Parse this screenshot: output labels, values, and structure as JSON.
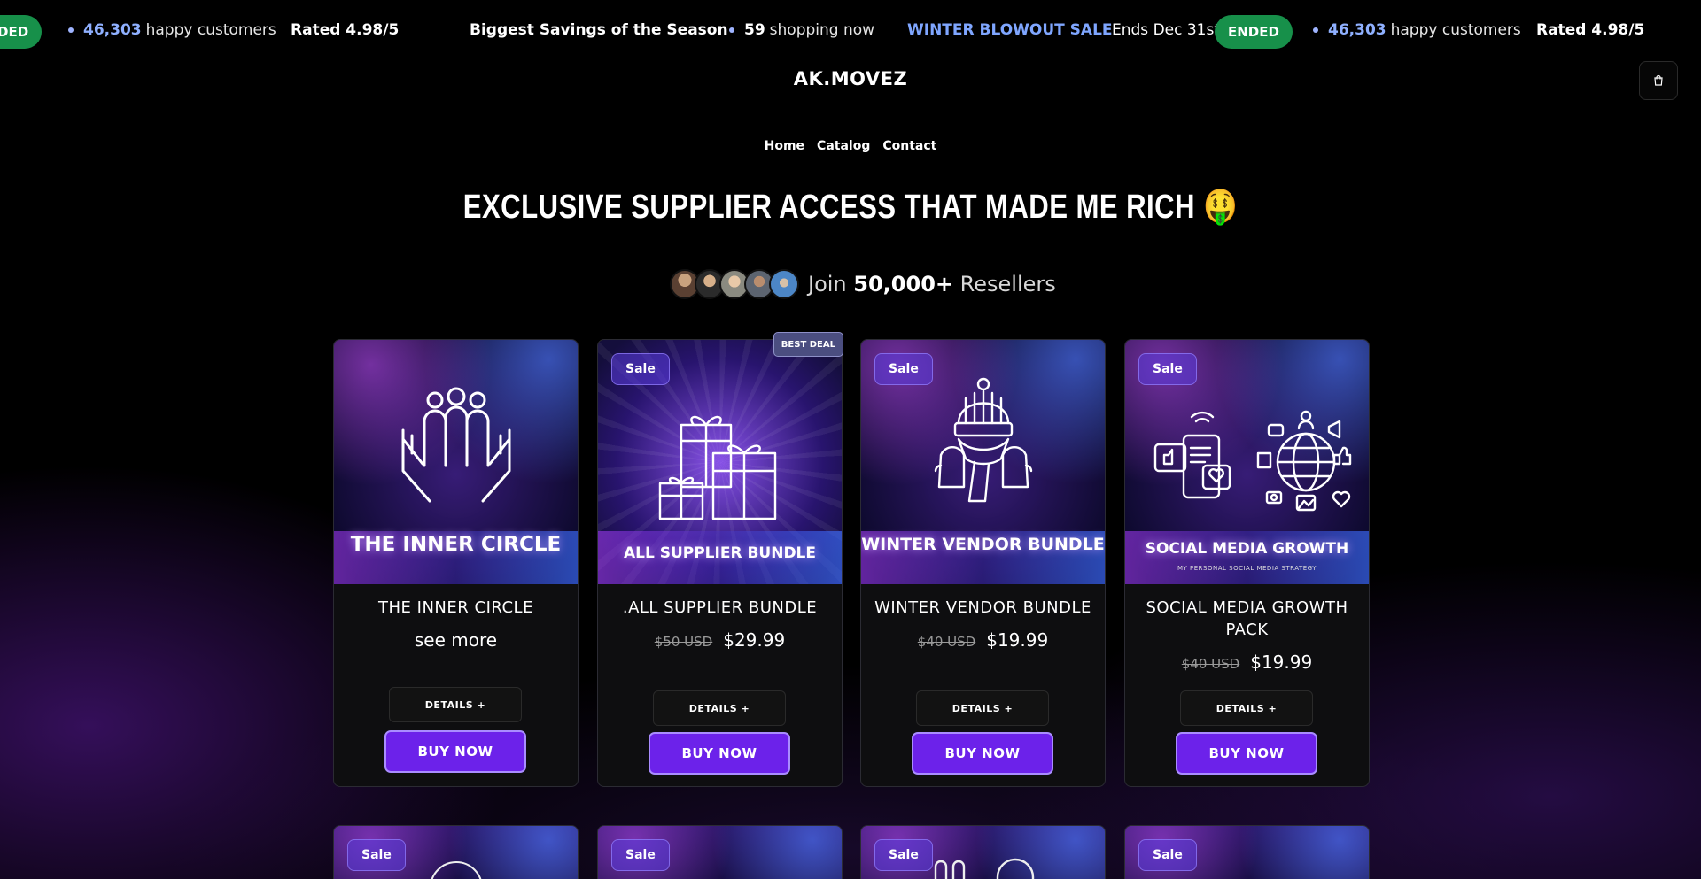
{
  "announcement": {
    "customers_count": "46,303",
    "customers_label": "happy customers",
    "rating": "Rated 4.98/5",
    "savings": "Biggest Savings of the Season",
    "shopping_count": "59",
    "shopping_label": "shopping now",
    "sale_name": "WINTER BLOWOUT SALE",
    "ends_label": "Ends Dec 31st:",
    "ended_badge": "ENDED",
    "ended_fragment": "DED"
  },
  "header": {
    "logo": "AK.MOVEZ",
    "nav": [
      "Home",
      "Catalog",
      "Contact"
    ]
  },
  "hero": {
    "headline": "EXCLUSIVE SUPPLIER ACCESS THAT MADE ME RICH 🤑",
    "social_prefix": "Join",
    "social_count": "50,000+",
    "social_suffix": "Resellers"
  },
  "products": [
    {
      "name": "THE INNER CIRCLE",
      "image_title": "THE INNER CIRCLE",
      "price_text": "see more",
      "details": "DETAILS +",
      "buy": "BUY NOW"
    },
    {
      "name": ".ALL SUPPLIER BUNDLE",
      "image_title": "ALL SUPPLIER BUNDLE",
      "badge": "Sale",
      "ribbon": "BEST DEAL",
      "old_price": "$50 USD",
      "price": "$29.99",
      "details": "DETAILS +",
      "buy": "BUY NOW"
    },
    {
      "name": "WINTER VENDOR BUNDLE",
      "image_title": "WINTER VENDOR BUNDLE",
      "badge": "Sale",
      "old_price": "$40 USD",
      "price": "$19.99",
      "details": "DETAILS +",
      "buy": "BUY NOW"
    },
    {
      "name": "SOCIAL MEDIA GROWTH PACK",
      "image_title": "SOCIAL MEDIA GROWTH",
      "image_subtitle": "MY PERSONAL SOCIAL MEDIA STRATEGY",
      "badge": "Sale",
      "old_price": "$40 USD",
      "price": "$19.99",
      "details": "DETAILS +",
      "buy": "BUY NOW"
    }
  ],
  "next_row": {
    "badges": [
      "Sale",
      "Sale",
      "Sale",
      "Sale"
    ]
  },
  "colors": {
    "accent": "#6c22ea",
    "ended_green": "#17904a",
    "highlight_blue": "#7fa6ff"
  },
  "icons": [
    "cart-icon",
    "hands-people-icon",
    "gift-boxes-icon",
    "winter-hat-scarf-icon",
    "social-media-icon"
  ]
}
